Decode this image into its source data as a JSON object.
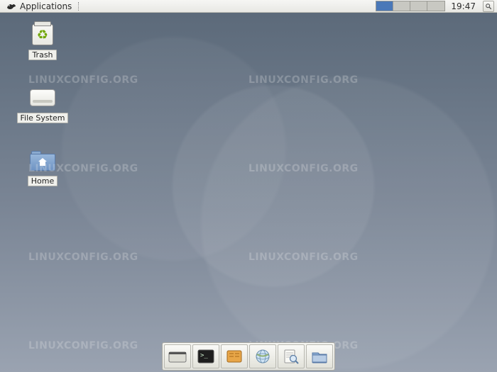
{
  "panel": {
    "app_menu_label": "Applications",
    "clock": "19:47",
    "workspaces": {
      "count": 4,
      "active_index": 0
    }
  },
  "desktop_icons": [
    {
      "id": "trash",
      "label": "Trash"
    },
    {
      "id": "filesystem",
      "label": "File System"
    },
    {
      "id": "home",
      "label": "Home"
    }
  ],
  "dock": [
    {
      "id": "show-desktop",
      "name": "show-desktop-icon"
    },
    {
      "id": "terminal",
      "name": "terminal-icon"
    },
    {
      "id": "file-manager",
      "name": "file-manager-icon"
    },
    {
      "id": "web-browser",
      "name": "web-browser-icon"
    },
    {
      "id": "app-finder",
      "name": "app-finder-icon"
    },
    {
      "id": "places",
      "name": "places-folder-icon"
    }
  ],
  "watermark_text": "LINUXCONFIG.ORG",
  "colors": {
    "panel_bg": "#ececE8",
    "ws_active": "#4a78b8",
    "folder_blue": "#7a9bc8"
  }
}
